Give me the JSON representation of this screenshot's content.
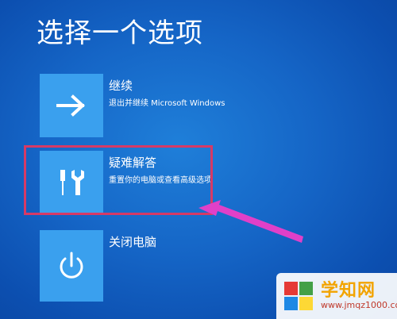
{
  "header": {
    "title": "选择一个选项"
  },
  "options": [
    {
      "label": "继续",
      "subtitle": "退出并继续 Microsoft Windows",
      "icon": "arrow-right-icon"
    },
    {
      "label": "疑难解答",
      "subtitle": "重置你的电脑或查看高级选项",
      "icon": "wrench-screwdriver-icon"
    },
    {
      "label": "关闭电脑",
      "icon": "power-icon"
    }
  ],
  "annotation": {
    "highlight_color": "#d63a66",
    "arrow_color": "#e040c8"
  },
  "watermark": {
    "title": "学知网",
    "url": "www.jmqz1000.com"
  },
  "colors": {
    "background": "#1565c6",
    "tile": "#3aa0ee"
  }
}
